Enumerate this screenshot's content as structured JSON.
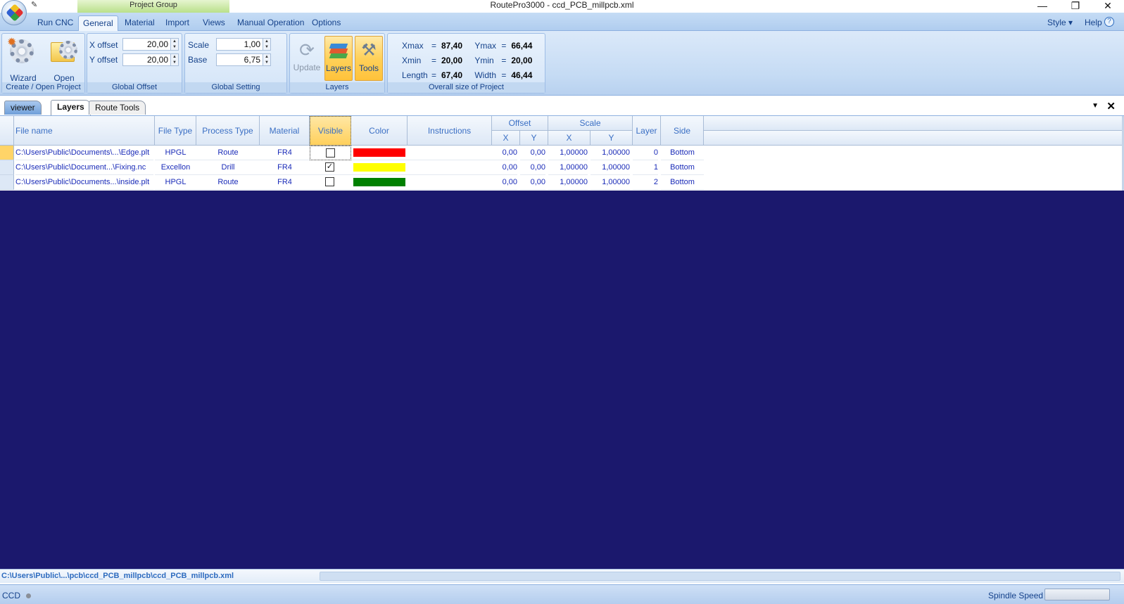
{
  "window": {
    "title": "RoutePro3000 - ccd_PCB_millpcb.xml",
    "project_group": "Project Group",
    "minimize": "—",
    "restore": "❐",
    "close": "✕"
  },
  "menu_tabs": [
    "Run CNC",
    "General",
    "Material",
    "Import",
    "Views",
    "Manual Operation",
    "Options"
  ],
  "menu_right": {
    "style": "Style",
    "style_arrow": "▾",
    "help": "Help",
    "help_icon": "?"
  },
  "ribbon": {
    "create_open": {
      "wizard": "Wizard",
      "open": "Open",
      "label": "Create / Open Project"
    },
    "global_offset": {
      "x_label": "X offset",
      "x_value": "20,00",
      "y_label": "Y offset",
      "y_value": "20,00",
      "label": "Global Offset"
    },
    "global_setting": {
      "scale_label": "Scale",
      "scale_value": "1,00",
      "base_label": "Base",
      "base_value": "6,75",
      "label": "Global Setting"
    },
    "layers": {
      "update": "Update",
      "layers": "Layers",
      "tools": "Tools",
      "label": "Layers"
    },
    "overall": {
      "xmax_label": "Xmax",
      "xmax": "87,40",
      "ymax_label": "Ymax",
      "ymax": "66,44",
      "xmin_label": "Xmin",
      "xmin": "20,00",
      "ymin_label": "Ymin",
      "ymin": "20,00",
      "length_label": "Length",
      "length": "67,40",
      "width_label": "Width",
      "width": "46,44",
      "eq": "=",
      "label": "Overall size of Project"
    }
  },
  "doc_tabs": [
    "viewer",
    "Layers",
    "Route Tools"
  ],
  "doc_controls": {
    "dropdown": "▼",
    "close": "✕"
  },
  "grid": {
    "headers": {
      "file_name": "File name",
      "file_type": "File Type",
      "process_type": "Process Type",
      "material": "Material",
      "visible": "Visible",
      "color": "Color",
      "instructions": "Instructions",
      "offset": "Offset",
      "offset_x": "X",
      "offset_y": "Y",
      "scale": "Scale",
      "scale_x": "X",
      "scale_y": "Y",
      "layer": "Layer",
      "side": "Side"
    },
    "rows": [
      {
        "file": "C:\\Users\\Public\\Documents\\...\\Edge.plt",
        "type": "HPGL",
        "process": "Route",
        "material": "FR4",
        "visible": "",
        "color": "#ff0000",
        "ox": "0,00",
        "oy": "0,00",
        "sx": "1,00000",
        "sy": "1,00000",
        "layer": "0",
        "side": "Bottom"
      },
      {
        "file": "C:\\Users\\Public\\Document...\\Fixing.nc",
        "type": "Excellon",
        "process": "Drill",
        "material": "FR4",
        "visible": "✓",
        "color": "#ffff00",
        "ox": "0,00",
        "oy": "0,00",
        "sx": "1,00000",
        "sy": "1,00000",
        "layer": "1",
        "side": "Bottom"
      },
      {
        "file": "C:\\Users\\Public\\Documents...\\inside.plt",
        "type": "HPGL",
        "process": "Route",
        "material": "FR4",
        "visible": "",
        "color": "#008000",
        "ox": "0,00",
        "oy": "0,00",
        "sx": "1,00000",
        "sy": "1,00000",
        "layer": "2",
        "side": "Bottom"
      }
    ]
  },
  "path_bar": "C:\\Users\\Public\\...\\pcb\\ccd_PCB_millpcb\\ccd_PCB_millpcb.xml",
  "status": {
    "left": "CCD",
    "spindle_label": "Spindle Speed"
  },
  "colors": {
    "viewer_bg": "#1b186d",
    "accent": "#15428b"
  }
}
